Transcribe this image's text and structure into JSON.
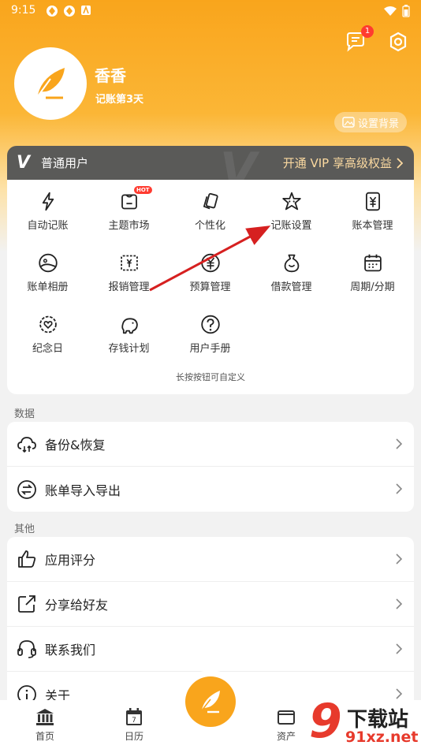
{
  "status_bar": {
    "time": "9:15"
  },
  "header": {
    "message_badge": "1"
  },
  "profile": {
    "name": "香香",
    "subtitle": "记账第3天",
    "background_button": "设置背景"
  },
  "vip": {
    "logo": "V",
    "user_type": "普通用户",
    "promo": "开通 VIP 享高级权益"
  },
  "grid": {
    "hot_badge": "HOT",
    "items": [
      {
        "label": "自动记账",
        "icon": "lightning-icon"
      },
      {
        "label": "主题市场",
        "icon": "shirt-icon"
      },
      {
        "label": "个性化",
        "icon": "cards-icon"
      },
      {
        "label": "记账设置",
        "icon": "star-face-icon"
      },
      {
        "label": "账本管理",
        "icon": "ledger-icon"
      },
      {
        "label": "账单相册",
        "icon": "photo-icon"
      },
      {
        "label": "报销管理",
        "icon": "receipt-icon"
      },
      {
        "label": "预算管理",
        "icon": "yen-circle-icon"
      },
      {
        "label": "借款管理",
        "icon": "money-bag-icon"
      },
      {
        "label": "周期/分期",
        "icon": "calendar-icon"
      },
      {
        "label": "纪念日",
        "icon": "anniversary-icon"
      },
      {
        "label": "存钱计划",
        "icon": "piggy-bank-icon"
      },
      {
        "label": "用户手册",
        "icon": "help-icon"
      }
    ],
    "hint": "长按按钮可自定义"
  },
  "data_section": {
    "title": "数据",
    "items": [
      {
        "label": "备份&恢复",
        "icon": "cloud-sync-icon"
      },
      {
        "label": "账单导入导出",
        "icon": "import-export-icon"
      }
    ]
  },
  "other_section": {
    "title": "其他",
    "items": [
      {
        "label": "应用评分",
        "icon": "thumbs-up-icon"
      },
      {
        "label": "分享给好友",
        "icon": "share-icon"
      },
      {
        "label": "联系我们",
        "icon": "headset-icon"
      },
      {
        "label": "关于",
        "icon": "info-icon"
      }
    ]
  },
  "bottom_nav": {
    "items": [
      {
        "label": "首页",
        "icon": "bank-icon"
      },
      {
        "label": "日历",
        "icon": "calendar-day-icon"
      },
      {
        "label": "资产",
        "icon": "wallet-icon"
      }
    ]
  },
  "watermark": {
    "digits": "9",
    "title": "下载站",
    "url": "91xz.net"
  },
  "colors": {
    "accent": "#f9a51c",
    "vip_bar": "#5a5a58",
    "vip_promo": "#fbd9a0",
    "annotation_arrow": "#d62020"
  }
}
